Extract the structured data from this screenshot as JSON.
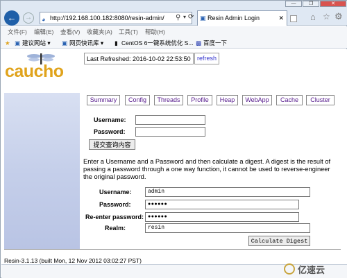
{
  "browser": {
    "url": "http://192.168.100.182:8080/resin-admin/",
    "url_suffix": "← ⟳",
    "search_icon": "search-icon",
    "tab_title": "Resin Admin Login",
    "menu": [
      "文件(F)",
      "编辑(E)",
      "查看(V)",
      "收藏夹(A)",
      "工具(T)",
      "帮助(H)"
    ],
    "favorites": [
      "建议网站 ▾",
      "网页快讯库 ▾",
      "CentOS 6一键系统优化 S...",
      "百度一下"
    ]
  },
  "header": {
    "logo_text": "caucho",
    "last_refreshed": "Last Refreshed: 2016-10-02 22:53:50",
    "refresh_label": "refresh"
  },
  "tabs": [
    "Summary",
    "Config",
    "Threads",
    "Profile",
    "Heap",
    "WebApp",
    "Cache",
    "Cluster"
  ],
  "login": {
    "username_label": "Username:",
    "password_label": "Password:",
    "submit_label": "提交查询内容",
    "username_value": "",
    "password_value": ""
  },
  "digest": {
    "description": "Enter a Username and a Password and then calculate a digest. A digest is the result of passing a password through a one way function, it cannot be used to reverse-engineer the original password.",
    "username_label": "Username:",
    "username_value": "admin",
    "password_label": "Password:",
    "password_value": "●●●●●●",
    "reenter_label": "Re-enter password:",
    "reenter_value": "●●●●●●",
    "realm_label": "Realm:",
    "realm_value": "resin",
    "button_label": "Calculate Digest"
  },
  "footer": {
    "version": "Resin-3.1.13 (built Mon, 12 Nov 2012 03:02:27 PST)"
  },
  "watermark": "亿速云"
}
